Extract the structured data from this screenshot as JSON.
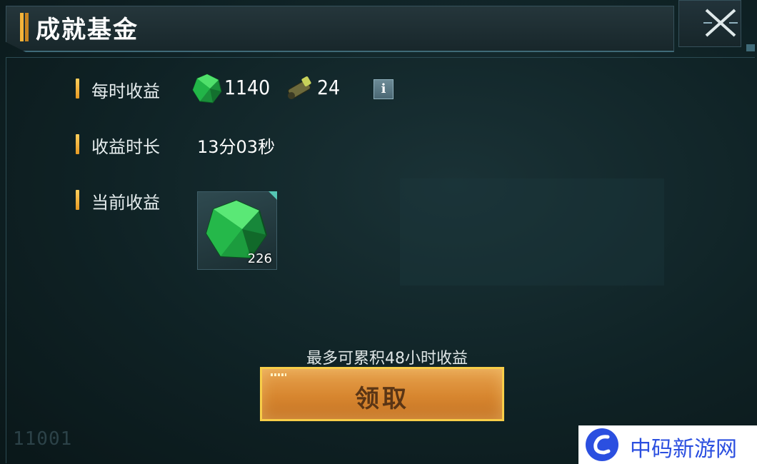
{
  "header": {
    "title": "成就基金"
  },
  "rows": {
    "hourly": {
      "label": "每时收益",
      "gem_value": "1140",
      "bullet_value": "24"
    },
    "duration": {
      "label": "收益时长",
      "value": "13分03秒"
    },
    "current": {
      "label": "当前收益",
      "item_qty": "226"
    }
  },
  "info_button": {
    "label": "i"
  },
  "hint": "最多可累积48小时收益",
  "claim_button": {
    "label": "领取"
  },
  "bottom_code": "11001",
  "watermark": {
    "text": "中码新游网"
  },
  "colors": {
    "accent": "#f4b33a",
    "button": "#d7862f",
    "gem": "#1fbf4a"
  }
}
